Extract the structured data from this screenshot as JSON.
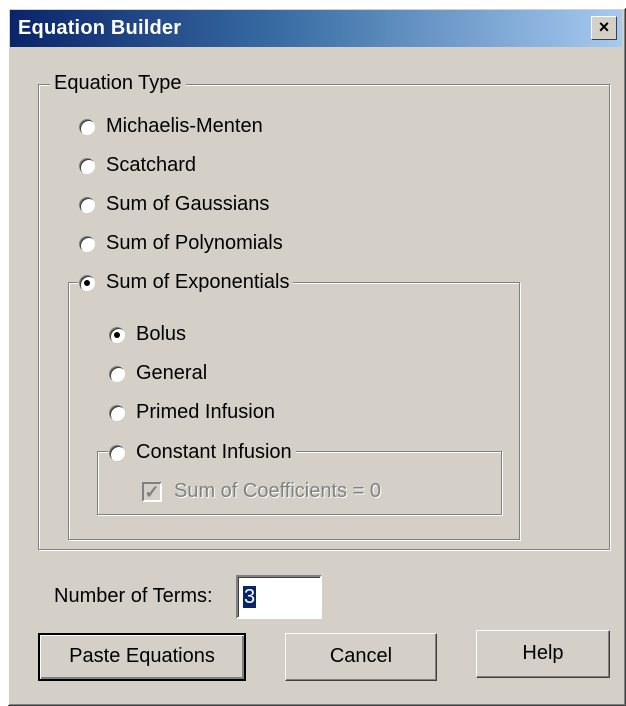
{
  "window": {
    "title": "Equation Builder",
    "close_glyph": "×"
  },
  "equation_type": {
    "legend": "Equation Type",
    "options": [
      {
        "label": "Michaelis-Menten",
        "checked": false
      },
      {
        "label": "Scatchard",
        "checked": false
      },
      {
        "label": "Sum of Gaussians",
        "checked": false
      },
      {
        "label": "Sum of Polynomials",
        "checked": false
      },
      {
        "label": "Sum of Exponentials",
        "checked": true
      }
    ]
  },
  "exponentials": {
    "options": [
      {
        "label": "Bolus",
        "checked": true
      },
      {
        "label": "General",
        "checked": false
      },
      {
        "label": "Primed Infusion",
        "checked": false
      },
      {
        "label": "Constant Infusion",
        "checked": false
      }
    ],
    "sum_coefficients": {
      "label": "Sum of Coefficients = 0",
      "checked": true,
      "disabled": true
    }
  },
  "terms": {
    "label": "Number of Terms:",
    "value": "3"
  },
  "buttons": {
    "paste": "Paste Equations",
    "cancel": "Cancel",
    "help": "Help"
  }
}
